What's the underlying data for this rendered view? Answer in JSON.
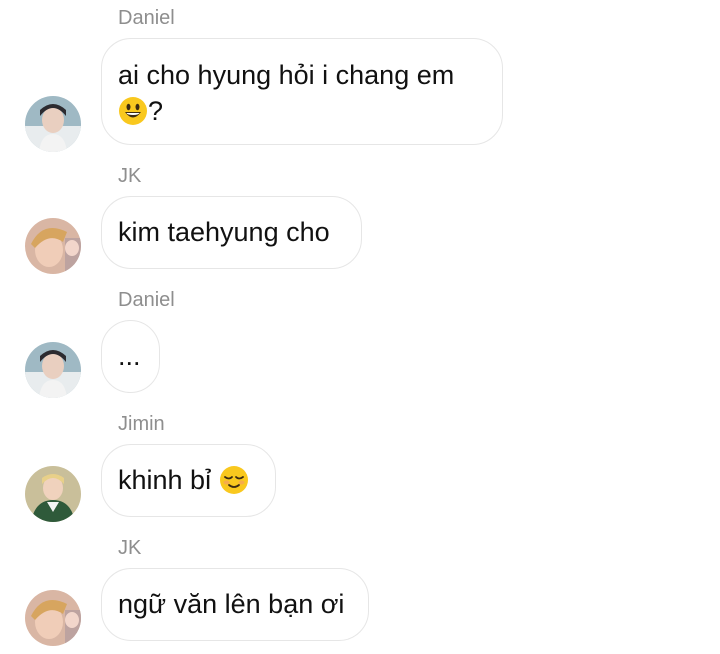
{
  "messages": [
    {
      "sender": "Daniel",
      "text_line1": "ai cho hyung hỏi i chang em",
      "text_line2_suffix": "?",
      "emoji": "grinning-face-emoji",
      "avatar": "daniel-avatar"
    },
    {
      "sender": "JK",
      "text": "kim taehyung cho",
      "avatar": "jk-avatar"
    },
    {
      "sender": "Daniel",
      "text": "...",
      "avatar": "daniel-avatar"
    },
    {
      "sender": "Jimin",
      "text": "khinh bỉ",
      "emoji": "relieved-face-emoji",
      "avatar": "jimin-avatar"
    },
    {
      "sender": "JK",
      "text": "ngữ văn lên bạn ơi",
      "avatar": "jk-avatar"
    }
  ],
  "colors": {
    "sender_name": "#8e8e8e",
    "bubble_border": "#e6e6e6",
    "message_text": "#111111",
    "emoji_yellow": "#f9c81e"
  }
}
